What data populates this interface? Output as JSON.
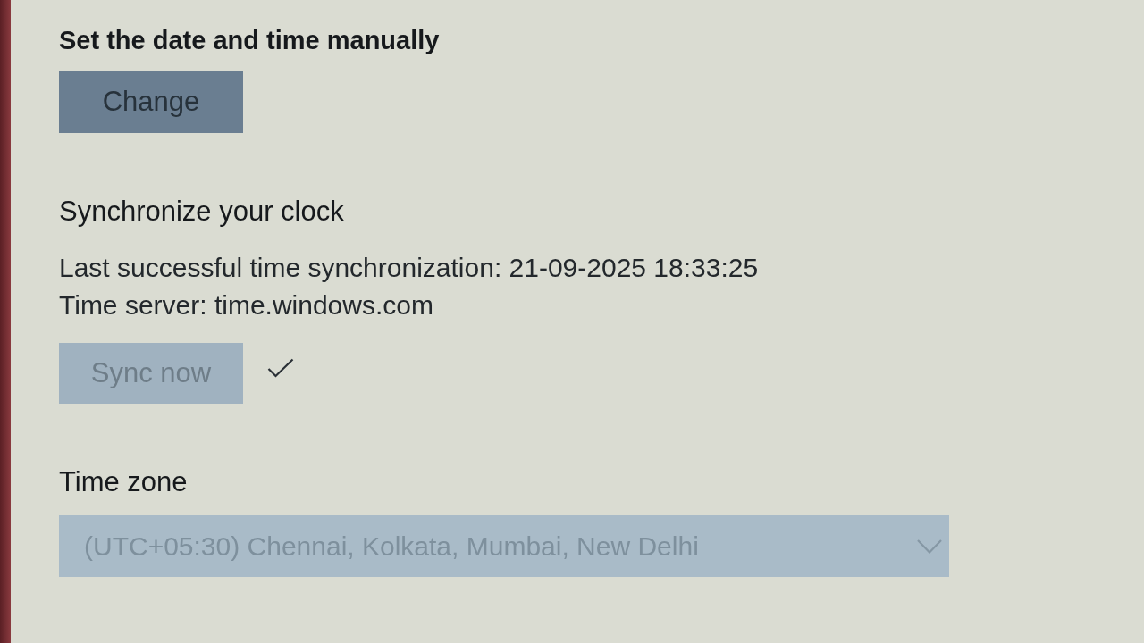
{
  "sections": [
    {
      "kind": "button",
      "heading": "Set the date and time manually",
      "button": {
        "label": "Change",
        "disabled": false
      }
    },
    {
      "kind": "sync",
      "heading": "Synchronize your clock",
      "lines": [
        "Last successful time synchronization: 21-09-2025 18:33:25",
        "Time server: time.windows.com"
      ],
      "button": {
        "label": "Sync now",
        "disabled": true
      },
      "synced": true
    },
    {
      "kind": "dropdown",
      "heading": "Time zone",
      "dropdown": {
        "value": "(UTC+05:30) Chennai, Kolkata, Mumbai, New Delhi",
        "disabled": true
      }
    }
  ]
}
